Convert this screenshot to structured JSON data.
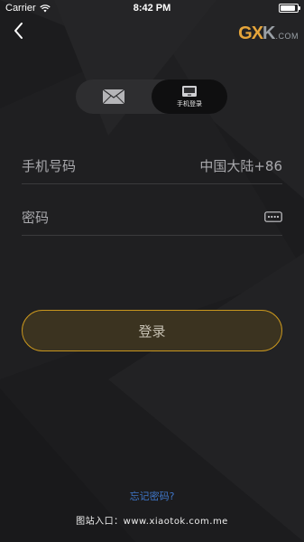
{
  "status_bar": {
    "carrier": "Carrier",
    "time": "8:42 PM",
    "battery_level": 0.9
  },
  "brand": {
    "mark_left": "GX",
    "mark_right": "K",
    "domain": ".COM"
  },
  "tabs": [
    {
      "name": "email",
      "icon": "mail-icon",
      "label": "",
      "active": false
    },
    {
      "name": "phone",
      "icon": "phone-icon",
      "label": "手机登录",
      "active": true
    }
  ],
  "form": {
    "phone_placeholder": "手机号码",
    "country_region": "中国大陆+86",
    "password_placeholder": "密码"
  },
  "login_button": "登录",
  "forgot_password": "忘记密码?",
  "watermark": "图站入口：www.xiaotok.com.me",
  "colors": {
    "accent": "#c8961e",
    "link": "#3f76c8",
    "background": "#1c1c1e"
  }
}
